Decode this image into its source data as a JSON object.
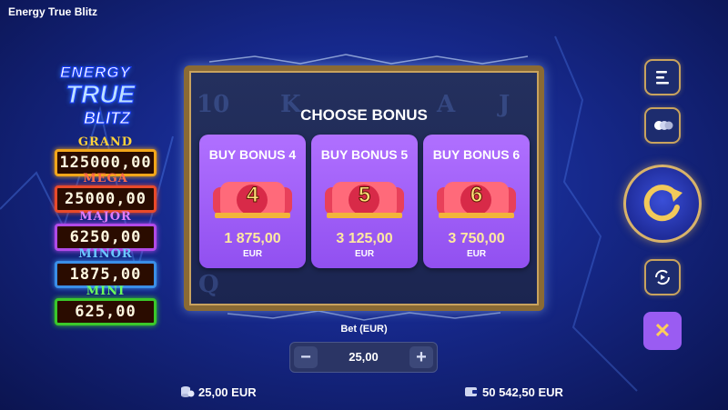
{
  "game_title": "Energy True Blitz",
  "logo": {
    "line1": "ENERGY",
    "line2": "TRUE",
    "line3": "BLITZ"
  },
  "jackpots": [
    {
      "label": "GRAND",
      "value": "125000,00",
      "label_color": "#ffd23a",
      "border": "#f2a61a"
    },
    {
      "label": "MEGA",
      "value": "25000,00",
      "label_color": "#ff6a4a",
      "border": "#e94a2a"
    },
    {
      "label": "MAJOR",
      "value": "6250,00",
      "label_color": "#e07cff",
      "border": "#b04ae8"
    },
    {
      "label": "MINOR",
      "value": "1875,00",
      "label_color": "#6ac8ff",
      "border": "#3a8ee8"
    },
    {
      "label": "MINI",
      "value": "625,00",
      "label_color": "#6aff5a",
      "border": "#3ac82a"
    }
  ],
  "bonus_dialog": {
    "title": "CHOOSE BONUS",
    "options": [
      {
        "title": "BUY BONUS 4",
        "number": "4",
        "price": "1 875,00",
        "currency": "EUR"
      },
      {
        "title": "BUY BONUS 5",
        "number": "5",
        "price": "3 125,00",
        "currency": "EUR"
      },
      {
        "title": "BUY BONUS 6",
        "number": "6",
        "price": "3 750,00",
        "currency": "EUR"
      }
    ]
  },
  "reel_symbols": [
    "10",
    "K",
    "A",
    "J",
    "Q"
  ],
  "bet": {
    "label": "Bet (EUR)",
    "value": "25,00",
    "minus": "−",
    "plus": "+"
  },
  "footer": {
    "bet_amount": "25,00 EUR",
    "balance": "50 542,50 EUR"
  },
  "controls": {
    "menu_icon": "menu-icon",
    "autoplay_icon": "coins-toggle-icon",
    "spin_icon": "spin-arrow-icon",
    "turbo_icon": "turbo-icon",
    "close_symbol": "✕"
  },
  "colors": {
    "accent_gold": "#c9a35e",
    "card_purple": "#a060fa",
    "background": "#16288a"
  }
}
